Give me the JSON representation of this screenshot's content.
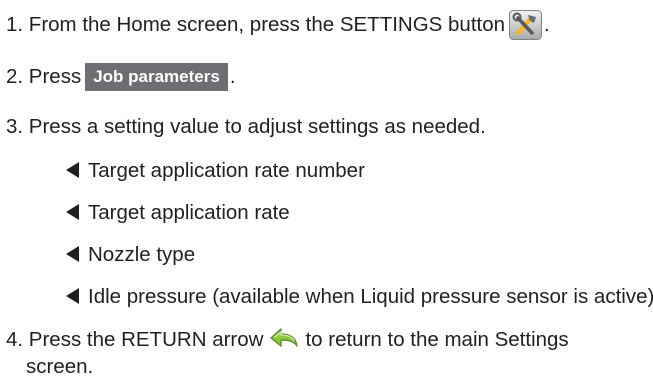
{
  "steps": {
    "step1": {
      "text": "1. From the Home screen, press the SETTINGS button",
      "icon": "settings-tools-icon",
      "end": "."
    },
    "step2": {
      "text": "2. Press",
      "button_label": "Job parameters",
      "end": "."
    },
    "step3": {
      "text": "3. Press a setting value to adjust settings as needed.",
      "items": [
        "Target application rate number",
        "Target application rate",
        "Nozzle type",
        "Idle pressure (available when Liquid pressure sensor is active)"
      ]
    },
    "step4": {
      "text_before": "4. Press the RETURN arrow",
      "icon": "return-arrow-icon",
      "text_after": "to return to the main Settings",
      "text_wrap": "screen."
    }
  },
  "colors": {
    "text": "#231f20",
    "button_bg": "#6d6e71",
    "return_arrow": "#8dc63f"
  }
}
